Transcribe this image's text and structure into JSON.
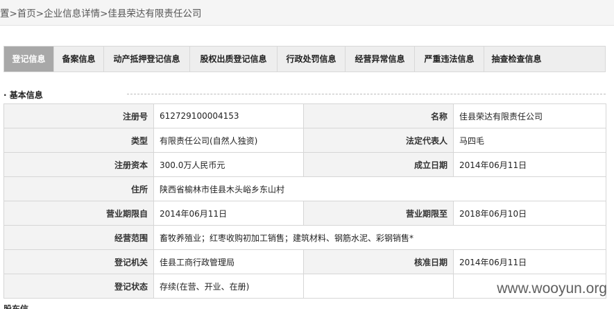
{
  "breadcrumb": "置>首页>企业信息详情>佳县荣达有限责任公司",
  "tabs": [
    "登记信息",
    "备案信息",
    "动产抵押登记信息",
    "股权出质登记信息",
    "行政处罚信息",
    "经营异常信息",
    "严重违法信息",
    "抽查检查信息"
  ],
  "section": {
    "title": "基本信息"
  },
  "info": {
    "reg_no_label": "注册号",
    "reg_no": "612729100004153",
    "name_label": "名称",
    "name": "佳县荣达有限责任公司",
    "type_label": "类型",
    "type": "有限责任公司(自然人独资)",
    "legal_rep_label": "法定代表人",
    "legal_rep": "马四毛",
    "capital_label": "注册资本",
    "capital": "300.0万人民币元",
    "founded_label": "成立日期",
    "founded": "2014年06月11日",
    "address_label": "住所",
    "address": "陕西省榆林市佳县木头峪乡东山村",
    "term_from_label": "营业期限自",
    "term_from": "2014年06月11日",
    "term_to_label": "营业期限至",
    "term_to": "2018年06月10日",
    "scope_label": "经营范围",
    "scope": "畜牧养殖业；红枣收购初加工销售；建筑材料、钢筋水泥、彩钢销售*",
    "authority_label": "登记机关",
    "authority": "佳县工商行政管理局",
    "approved_label": "核准日期",
    "approved": "2014年06月11日",
    "status_label": "登记状态",
    "status": "存续(在营、开业、在册)"
  },
  "watermark": "www.wooyun.org",
  "bottom_fragment": "股东信"
}
